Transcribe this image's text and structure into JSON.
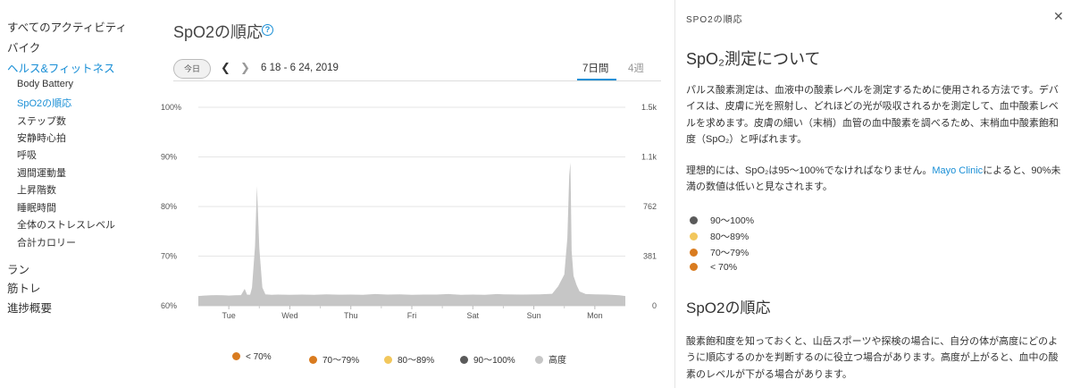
{
  "sidebar": {
    "items": [
      {
        "label": "すべてのアクティビティ",
        "active": false
      },
      {
        "label": "バイク",
        "active": false
      },
      {
        "label": "ヘルス&フィットネス",
        "active": true
      }
    ],
    "sub_items": [
      {
        "label": "Body Battery",
        "active": false
      },
      {
        "label": "SpO2の順応",
        "active": true
      },
      {
        "label": "ステップ数",
        "active": false
      },
      {
        "label": "安静時心拍",
        "active": false
      },
      {
        "label": "呼吸",
        "active": false
      },
      {
        "label": "週間運動量",
        "active": false
      },
      {
        "label": "上昇階数",
        "active": false
      },
      {
        "label": "睡眠時間",
        "active": false
      },
      {
        "label": "全体のストレスレベル",
        "active": false
      },
      {
        "label": "合計カロリー",
        "active": false
      }
    ],
    "bottom_items": [
      {
        "label": "ラン"
      },
      {
        "label": "筋トレ"
      },
      {
        "label": "進捗概要"
      }
    ]
  },
  "main": {
    "title": "SpO2の順応",
    "help_icon": "question-circle-icon",
    "toolbar": {
      "today_label": "今日",
      "prev_icon": "chevron-left-icon",
      "next_icon": "chevron-right-icon",
      "date_range": "6 18 - 6 24, 2019",
      "tabs": [
        {
          "label": "7日間",
          "active": true
        },
        {
          "label": "4週",
          "active": false
        }
      ]
    },
    "legend": [
      {
        "label": "< 70%",
        "color": "#d97b1f"
      },
      {
        "label": "70～79%",
        "color": "#d97b1f"
      },
      {
        "label": "80～89%",
        "color": "#f2c75c"
      },
      {
        "label": "90～100%",
        "color": "#5a5a5a"
      },
      {
        "label": "高度",
        "color": "#c6c6c6"
      }
    ]
  },
  "chart_data": {
    "type": "area",
    "x_labels": [
      "Tue",
      "Wed",
      "Thu",
      "Fri",
      "Sat",
      "Sun",
      "Mon"
    ],
    "y_left_ticks": [
      "100%",
      "90%",
      "80%",
      "70%",
      "60%"
    ],
    "y_right_ticks": [
      "1.5k",
      "1.1k",
      "762",
      "381",
      "0"
    ],
    "y_left_range": [
      60,
      100
    ],
    "y_right_range": [
      0,
      1524
    ],
    "grid": true,
    "legend_position": "bottom",
    "series": [
      {
        "name": "高度",
        "color": "#c6c6c6",
        "x": [
          0,
          0.1,
          0.2,
          0.3,
          0.4,
          0.5,
          0.6,
          0.7,
          0.76,
          0.8,
          0.85,
          0.88,
          0.93,
          0.96,
          1.0,
          1.05,
          1.1,
          1.2,
          1.3,
          1.5,
          1.7,
          1.9,
          2.1,
          2.3,
          2.5,
          2.7,
          2.9,
          3.1,
          3.3,
          3.5,
          3.7,
          3.9,
          4.1,
          4.3,
          4.5,
          4.7,
          4.9,
          5.0,
          5.3,
          5.6,
          5.8,
          5.9,
          6.0,
          6.05,
          6.08,
          6.1,
          6.12,
          6.15,
          6.2,
          6.25,
          6.35,
          6.5,
          6.7,
          6.9,
          7.0
        ],
        "y": [
          75,
          78,
          80,
          82,
          80,
          78,
          80,
          82,
          130,
          85,
          85,
          140,
          460,
          920,
          440,
          140,
          88,
          84,
          86,
          84,
          86,
          84,
          88,
          85,
          86,
          84,
          90,
          86,
          88,
          84,
          86,
          86,
          90,
          84,
          86,
          84,
          90,
          88,
          86,
          88,
          92,
          150,
          240,
          520,
          1000,
          1100,
          420,
          230,
          160,
          110,
          90,
          88,
          86,
          80,
          75
        ]
      }
    ]
  },
  "panel": {
    "title": "SPO2の順応",
    "close_icon": "close-icon",
    "heading1": "SpO₂測定について",
    "para1": "パルス酸素測定は、血液中の酸素レベルを測定するために使用される方法です。デバイスは、皮膚に光を照射し、どれほどの光が吸収されるかを測定して、血中酸素レベルを求めます。皮膚の細い（末梢）血管の血中酸素を調べるため、末梢血中酸素飽和度（SpO₂）と呼ばれます。",
    "para2_pre": "理想的には、SpO₂は95～100%でなければなりません。",
    "para2_link": "Mayo Clinic",
    "para2_post": "によると、90%未満の数値は低いと見なされます。",
    "levels": [
      {
        "label": "90～100%",
        "color": "#5a5a5a"
      },
      {
        "label": "80～89%",
        "color": "#f2c75c"
      },
      {
        "label": "70～79%",
        "color": "#d97b1f"
      },
      {
        "label": "< 70%",
        "color": "#d97b1f"
      }
    ],
    "heading2": "SpO2の順応",
    "para3": "酸素飽和度を知っておくと、山岳スポーツや探検の場合に、自分の体が高度にどのように順応するのかを判断するのに役立つ場合があります。高度が上がると、血中の酸素のレベルが下がる場合があります。"
  }
}
